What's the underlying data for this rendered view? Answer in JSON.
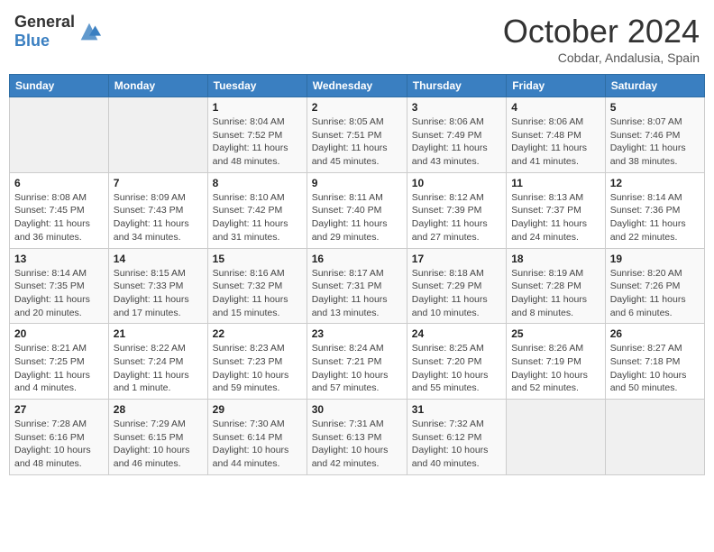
{
  "header": {
    "logo_general": "General",
    "logo_blue": "Blue",
    "month_title": "October 2024",
    "subtitle": "Cobdar, Andalusia, Spain"
  },
  "days_of_week": [
    "Sunday",
    "Monday",
    "Tuesday",
    "Wednesday",
    "Thursday",
    "Friday",
    "Saturday"
  ],
  "weeks": [
    [
      {
        "day": "",
        "info": ""
      },
      {
        "day": "",
        "info": ""
      },
      {
        "day": "1",
        "info": "Sunrise: 8:04 AM\nSunset: 7:52 PM\nDaylight: 11 hours and 48 minutes."
      },
      {
        "day": "2",
        "info": "Sunrise: 8:05 AM\nSunset: 7:51 PM\nDaylight: 11 hours and 45 minutes."
      },
      {
        "day": "3",
        "info": "Sunrise: 8:06 AM\nSunset: 7:49 PM\nDaylight: 11 hours and 43 minutes."
      },
      {
        "day": "4",
        "info": "Sunrise: 8:06 AM\nSunset: 7:48 PM\nDaylight: 11 hours and 41 minutes."
      },
      {
        "day": "5",
        "info": "Sunrise: 8:07 AM\nSunset: 7:46 PM\nDaylight: 11 hours and 38 minutes."
      }
    ],
    [
      {
        "day": "6",
        "info": "Sunrise: 8:08 AM\nSunset: 7:45 PM\nDaylight: 11 hours and 36 minutes."
      },
      {
        "day": "7",
        "info": "Sunrise: 8:09 AM\nSunset: 7:43 PM\nDaylight: 11 hours and 34 minutes."
      },
      {
        "day": "8",
        "info": "Sunrise: 8:10 AM\nSunset: 7:42 PM\nDaylight: 11 hours and 31 minutes."
      },
      {
        "day": "9",
        "info": "Sunrise: 8:11 AM\nSunset: 7:40 PM\nDaylight: 11 hours and 29 minutes."
      },
      {
        "day": "10",
        "info": "Sunrise: 8:12 AM\nSunset: 7:39 PM\nDaylight: 11 hours and 27 minutes."
      },
      {
        "day": "11",
        "info": "Sunrise: 8:13 AM\nSunset: 7:37 PM\nDaylight: 11 hours and 24 minutes."
      },
      {
        "day": "12",
        "info": "Sunrise: 8:14 AM\nSunset: 7:36 PM\nDaylight: 11 hours and 22 minutes."
      }
    ],
    [
      {
        "day": "13",
        "info": "Sunrise: 8:14 AM\nSunset: 7:35 PM\nDaylight: 11 hours and 20 minutes."
      },
      {
        "day": "14",
        "info": "Sunrise: 8:15 AM\nSunset: 7:33 PM\nDaylight: 11 hours and 17 minutes."
      },
      {
        "day": "15",
        "info": "Sunrise: 8:16 AM\nSunset: 7:32 PM\nDaylight: 11 hours and 15 minutes."
      },
      {
        "day": "16",
        "info": "Sunrise: 8:17 AM\nSunset: 7:31 PM\nDaylight: 11 hours and 13 minutes."
      },
      {
        "day": "17",
        "info": "Sunrise: 8:18 AM\nSunset: 7:29 PM\nDaylight: 11 hours and 10 minutes."
      },
      {
        "day": "18",
        "info": "Sunrise: 8:19 AM\nSunset: 7:28 PM\nDaylight: 11 hours and 8 minutes."
      },
      {
        "day": "19",
        "info": "Sunrise: 8:20 AM\nSunset: 7:26 PM\nDaylight: 11 hours and 6 minutes."
      }
    ],
    [
      {
        "day": "20",
        "info": "Sunrise: 8:21 AM\nSunset: 7:25 PM\nDaylight: 11 hours and 4 minutes."
      },
      {
        "day": "21",
        "info": "Sunrise: 8:22 AM\nSunset: 7:24 PM\nDaylight: 11 hours and 1 minute."
      },
      {
        "day": "22",
        "info": "Sunrise: 8:23 AM\nSunset: 7:23 PM\nDaylight: 10 hours and 59 minutes."
      },
      {
        "day": "23",
        "info": "Sunrise: 8:24 AM\nSunset: 7:21 PM\nDaylight: 10 hours and 57 minutes."
      },
      {
        "day": "24",
        "info": "Sunrise: 8:25 AM\nSunset: 7:20 PM\nDaylight: 10 hours and 55 minutes."
      },
      {
        "day": "25",
        "info": "Sunrise: 8:26 AM\nSunset: 7:19 PM\nDaylight: 10 hours and 52 minutes."
      },
      {
        "day": "26",
        "info": "Sunrise: 8:27 AM\nSunset: 7:18 PM\nDaylight: 10 hours and 50 minutes."
      }
    ],
    [
      {
        "day": "27",
        "info": "Sunrise: 7:28 AM\nSunset: 6:16 PM\nDaylight: 10 hours and 48 minutes."
      },
      {
        "day": "28",
        "info": "Sunrise: 7:29 AM\nSunset: 6:15 PM\nDaylight: 10 hours and 46 minutes."
      },
      {
        "day": "29",
        "info": "Sunrise: 7:30 AM\nSunset: 6:14 PM\nDaylight: 10 hours and 44 minutes."
      },
      {
        "day": "30",
        "info": "Sunrise: 7:31 AM\nSunset: 6:13 PM\nDaylight: 10 hours and 42 minutes."
      },
      {
        "day": "31",
        "info": "Sunrise: 7:32 AM\nSunset: 6:12 PM\nDaylight: 10 hours and 40 minutes."
      },
      {
        "day": "",
        "info": ""
      },
      {
        "day": "",
        "info": ""
      }
    ]
  ]
}
